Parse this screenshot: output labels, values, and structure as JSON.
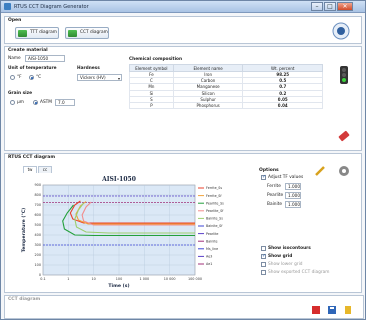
{
  "window": {
    "title": "RTUS CCT Diagram Generator",
    "minimize": "–",
    "maximize": "□",
    "close": "✕"
  },
  "open": {
    "title": "Open",
    "ttt_label": "TTT diagram",
    "cct_label": "CCT diagram"
  },
  "material": {
    "title": "Create material",
    "name_label": "Name",
    "name_value": "AISI-1050",
    "unit_title": "Unit of temperature",
    "unit_c": "°F",
    "unit_f": "°C",
    "hardness_title": "Hardness",
    "hardness_value": "Vickers (HV)",
    "grain_title": "Grain size",
    "grain_um": "µm",
    "grain_astm": "ASTM",
    "grain_value": "7.0"
  },
  "chemical": {
    "title": "Chemical composition",
    "headers": [
      "Element symbol",
      "Element name",
      "Wt. percent"
    ],
    "rows": [
      [
        "Fe",
        "Iron",
        "98.25"
      ],
      [
        "C",
        "Carbon",
        "0.5"
      ],
      [
        "Mn",
        "Manganese",
        "0.7"
      ],
      [
        "Si",
        "Silicon",
        "0.2"
      ],
      [
        "S",
        "Sulphur",
        "0.05"
      ],
      [
        "P",
        "Phosphorus",
        "0.04"
      ]
    ]
  },
  "diagram_panel": {
    "title": "RTUS CCT diagram",
    "tab_ttt": "tw",
    "tab_cct": "cc"
  },
  "options": {
    "title": "Options",
    "adjust_label": "Adjust TF values",
    "ferrite_label": "Ferrite",
    "ferrite_value": "1.000",
    "pearlite_label": "Pearlite",
    "pearlite_value": "1.000",
    "bainite_label": "Bainite",
    "bainite_value": "1.000",
    "show_contours": "Show isocontours",
    "show_grid": "Show grid",
    "show_lower": "Show lower grid",
    "show_exported": "Show exported CCT diagram"
  },
  "bottom": {
    "title": "CCT diagram"
  },
  "chart_data": {
    "type": "line",
    "title": "AISI-1050",
    "xlabel": "Time (s)",
    "ylabel": "Temperature (°C)",
    "xscale": "log",
    "xlim": [
      0.1,
      100000
    ],
    "ylim": [
      0,
      900
    ],
    "x_ticks": [
      "0.1",
      "1",
      "10",
      "100",
      "1 000",
      "10 000",
      "100 000"
    ],
    "y_ticks": [
      "0",
      "100",
      "200",
      "300",
      "400",
      "500",
      "600",
      "700",
      "800",
      "900"
    ],
    "grid": true,
    "legend_position": "right",
    "legend": [
      "Ferrite_Ss",
      "Ferrite_Sf",
      "Pearlite_Ss",
      "Pearlite_Sf",
      "Bainite_Ss",
      "Bainite_Sf",
      "Pearlite",
      "Bainite",
      "Ms_line",
      "Ae3",
      "Ae1"
    ],
    "horizontal_lines": [
      {
        "name": "Ae3",
        "y": 790,
        "color": "#5a3fc8"
      },
      {
        "name": "Ae1",
        "y": 725,
        "color": "#a0307a"
      },
      {
        "name": "Ms",
        "y": 300,
        "color": "#3b45d6"
      }
    ],
    "series": [
      {
        "color": "#e8412c",
        "x": [
          3,
          1.8,
          1.2,
          1.5,
          4,
          30,
          300,
          100000
        ],
        "y": [
          740,
          700,
          620,
          560,
          520,
          520,
          520,
          520
        ]
      },
      {
        "color": "#f2a33a",
        "x": [
          5,
          3,
          2,
          2.5,
          6,
          60,
          800,
          100000
        ],
        "y": [
          735,
          690,
          610,
          550,
          510,
          510,
          510,
          510
        ]
      },
      {
        "color": "#22a03a",
        "x": [
          1.6,
          0.9,
          0.6,
          0.7,
          1.8,
          10,
          100,
          100000
        ],
        "y": [
          700,
          620,
          540,
          460,
          400,
          395,
          395,
          395
        ]
      },
      {
        "color": "#f28c8c",
        "x": [
          8,
          5,
          3.5,
          4,
          10,
          80,
          2000,
          100000
        ],
        "y": [
          730,
          680,
          600,
          540,
          500,
          500,
          500,
          500
        ]
      },
      {
        "color": "#9ccf6e",
        "x": [
          4,
          2.5,
          1.8,
          2.1,
          5,
          40,
          300,
          100000
        ],
        "y": [
          720,
          650,
          560,
          480,
          430,
          420,
          420,
          420
        ]
      }
    ]
  }
}
